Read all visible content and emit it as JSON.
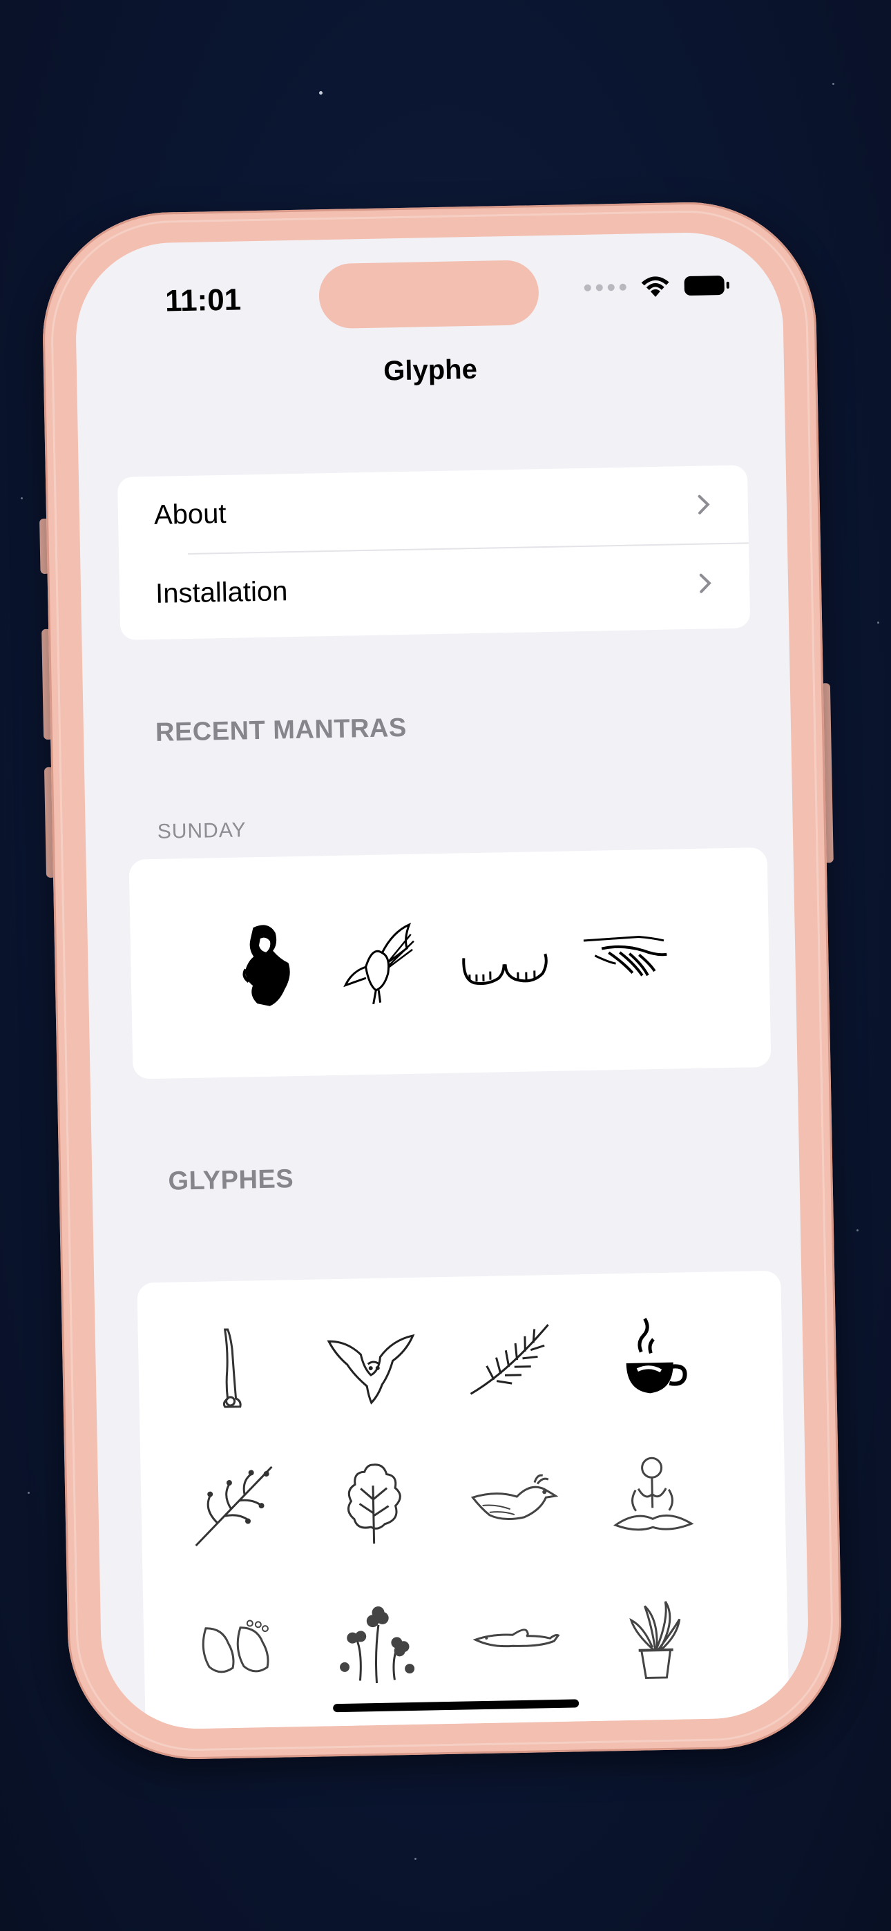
{
  "status_bar": {
    "time": "11:01",
    "icons": [
      "signal-dots-icon",
      "wifi-icon",
      "battery-icon"
    ]
  },
  "nav": {
    "title": "Glyphe"
  },
  "menu": {
    "items": [
      {
        "label": "About",
        "icon": "chevron-right-icon"
      },
      {
        "label": "Installation",
        "icon": "chevron-right-icon"
      }
    ]
  },
  "recent": {
    "section_title": "RECENT MANTRAS",
    "day_label": "SUNDAY",
    "glyphs": [
      "woman-portrait-icon",
      "owl-icon",
      "feet-icon",
      "hands-icon"
    ]
  },
  "glyphes": {
    "section_title": "GLYPHES",
    "glyphs": [
      "headstand-icon",
      "owl-flying-icon",
      "rosemary-icon",
      "coffee-cup-icon",
      "berry-branch-icon",
      "oak-leaf-icon",
      "bird-icon",
      "meditation-icon",
      "feet-icon",
      "clover-icon",
      "dolphin-icon",
      "potted-plant-icon"
    ]
  },
  "colors": {
    "background": "#0a1530",
    "phone_frame": "#f3bfb0",
    "screen_bg": "#f2f1f6",
    "card_bg": "#ffffff",
    "section_text": "#86858c"
  }
}
